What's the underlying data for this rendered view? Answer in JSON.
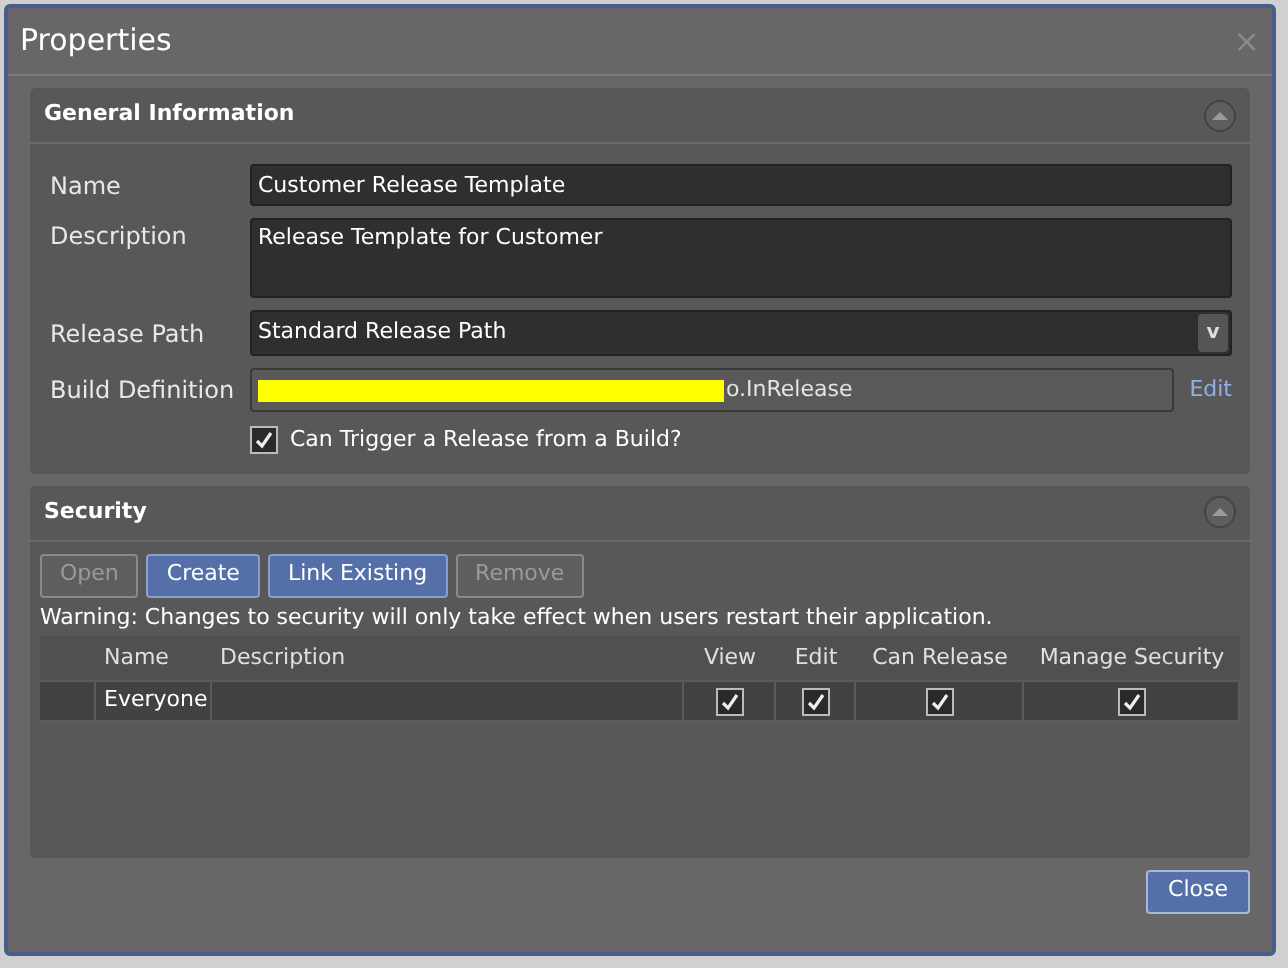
{
  "window": {
    "title": "Properties",
    "close": "×"
  },
  "general": {
    "title": "General Information",
    "name": {
      "label": "Name",
      "value": "Customer Release Template"
    },
    "description": {
      "label": "Description",
      "value": "Release Template for Customer"
    },
    "release_path": {
      "label": "Release Path",
      "value": "Standard Release Path",
      "caret": "v"
    },
    "build_definition": {
      "label": "Build Definition",
      "value": "o.InRelease",
      "redacted": true,
      "link": "Edit"
    },
    "trigger": {
      "label": "Can Trigger a Release from a Build?",
      "checked": true
    }
  },
  "security": {
    "title": "Security",
    "buttons": [
      {
        "label": "Open",
        "disabled": true
      },
      {
        "label": "Create",
        "disabled": false
      },
      {
        "label": "Link Existing",
        "disabled": false
      },
      {
        "label": "Remove",
        "disabled": true
      }
    ],
    "warning": "Warning: Changes to security will only take effect when users restart their application.",
    "table": {
      "columns": [
        "Name",
        "Description",
        "View",
        "Edit",
        "Can Release",
        "Manage Security"
      ],
      "rows": [
        {
          "name": "Everyone",
          "description": "",
          "view": true,
          "edit": true,
          "can_release": true,
          "manage_security": true
        }
      ]
    }
  },
  "footer": {
    "close": "Close"
  }
}
